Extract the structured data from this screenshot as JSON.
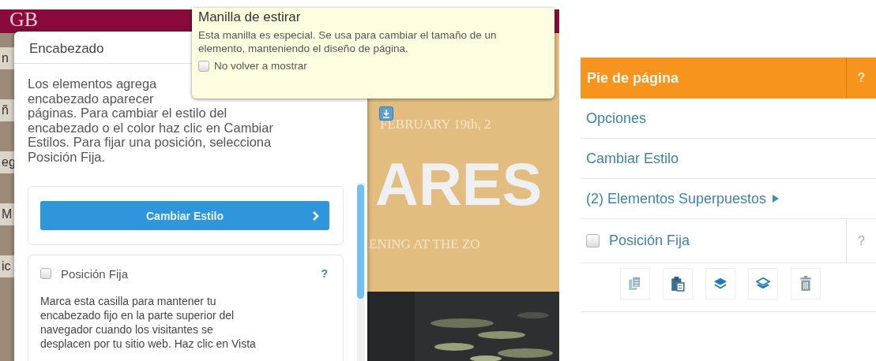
{
  "site_background": {
    "logo": "GB",
    "side_fragments": [
      "n",
      "ñ",
      "eg",
      "M",
      "ic"
    ],
    "date": "FEBRUARY 19th, 2",
    "headline": "ARES",
    "subtitle": "ENING AT THE ZO"
  },
  "header_panel": {
    "title": "Encabezado",
    "intro_lines": [
      "Los elementos agrega",
      "encabezado aparecer"
    ],
    "intro_rest": "páginas. Para cambiar el estilo del encabezado o el color haz clic en Cambiar Estilos. Para fijar una posición, selecciona Posición Fija.",
    "style_button": {
      "label": "Cambiar Estilo"
    },
    "fixed_position": {
      "label": "Posición Fija",
      "checked": false,
      "help": "?",
      "description": "Marca esta casilla para mantener tu encabezado fijo en la parte superior del navegador cuando los visitantes se desplacen por tu sitio web. Haz clic en Vista"
    }
  },
  "tooltip": {
    "title": "Manilla de estirar",
    "body": "Esta manilla es especial. Se usa para cambiar el tamaño de un elemento, manteniendo el diseño de página.",
    "dont_show_again": {
      "label": "No volver a mostrar",
      "checked": false
    }
  },
  "footer_menu": {
    "title": "Pie de página",
    "help": "?",
    "items": [
      {
        "kind": "link",
        "label": "Opciones"
      },
      {
        "kind": "link",
        "label": "Cambiar Estilo"
      },
      {
        "kind": "submenu",
        "label": "(2) Elementos Superpuestos"
      },
      {
        "kind": "checkbox",
        "label": "Posición Fija",
        "checked": false,
        "help": "?"
      }
    ],
    "tools": [
      {
        "kind": "copy"
      },
      {
        "kind": "paste"
      },
      {
        "kind": "bring-forward"
      },
      {
        "kind": "send-backward"
      },
      {
        "kind": "delete"
      }
    ]
  }
}
